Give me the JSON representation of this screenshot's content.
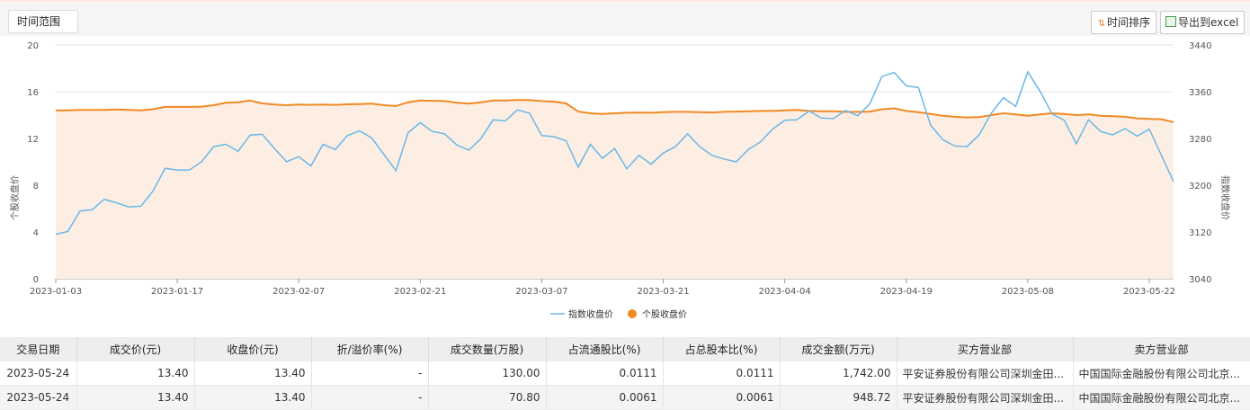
{
  "toolbar": {
    "range_label": "时间范围",
    "sort_label": "时间排序",
    "export_label": "导出到excel"
  },
  "colors": {
    "index_line": "#6bb7e6",
    "stock_line": "#f08a24",
    "stock_fill": "#fdeee3"
  },
  "chart_data": {
    "type": "line",
    "y_left_label": "个股收盘价",
    "y_right_label": "指数收盘价",
    "y_left_ticks": [
      "0",
      "4",
      "8",
      "12",
      "16",
      "20"
    ],
    "y_right_ticks": [
      "3040",
      "3120",
      "3200",
      "3280",
      "3360",
      "3440"
    ],
    "y_left_range": [
      0,
      20
    ],
    "y_right_range": [
      3040,
      3440
    ],
    "x_tick_labels": [
      "2023-01-03",
      "2023-01-17",
      "2023-02-07",
      "2023-02-21",
      "2023-03-07",
      "2023-03-21",
      "2023-04-04",
      "2023-04-19",
      "2023-05-08",
      "2023-05-22"
    ],
    "x_tick_positions": [
      0,
      10,
      20,
      30,
      40,
      50,
      60,
      70,
      80,
      90
    ],
    "grid": true,
    "legend_position": "bottom",
    "series": [
      {
        "name": "指数收盘价",
        "axis": "right",
        "values": [
          3116,
          3121,
          3156,
          3158,
          3176,
          3170,
          3163,
          3164,
          3190,
          3229,
          3226,
          3226,
          3240,
          3266,
          3270,
          3258,
          3286,
          3287,
          3263,
          3240,
          3249,
          3233,
          3270,
          3261,
          3285,
          3293,
          3281,
          3253,
          3225,
          3290,
          3307,
          3292,
          3288,
          3269,
          3260,
          3280,
          3312,
          3310,
          3329,
          3323,
          3285,
          3283,
          3276,
          3231,
          3270,
          3246,
          3263,
          3228,
          3251,
          3236,
          3255,
          3266,
          3288,
          3266,
          3251,
          3245,
          3240,
          3261,
          3274,
          3296,
          3311,
          3312,
          3327,
          3315,
          3314,
          3328,
          3319,
          3339,
          3386,
          3393,
          3370,
          3367,
          3303,
          3278,
          3267,
          3266,
          3286,
          3323,
          3350,
          3335,
          3394,
          3361,
          3322,
          3311,
          3271,
          3312,
          3292,
          3286,
          3297,
          3284,
          3296,
          3251,
          3206
        ]
      },
      {
        "name": "个股收盘价",
        "axis": "left",
        "values": [
          14.4,
          14.4,
          14.45,
          14.45,
          14.45,
          14.48,
          14.45,
          14.4,
          14.5,
          14.7,
          14.7,
          14.7,
          14.72,
          14.85,
          15.05,
          15.1,
          15.25,
          15.0,
          14.9,
          14.85,
          14.9,
          14.88,
          14.9,
          14.88,
          14.92,
          14.95,
          14.98,
          14.85,
          14.78,
          15.1,
          15.25,
          15.22,
          15.2,
          15.05,
          14.98,
          15.1,
          15.25,
          15.25,
          15.3,
          15.28,
          15.2,
          15.15,
          15.0,
          14.3,
          14.15,
          14.1,
          14.15,
          14.2,
          14.22,
          14.2,
          14.25,
          14.28,
          14.28,
          14.25,
          14.22,
          14.28,
          14.3,
          14.32,
          14.35,
          14.35,
          14.4,
          14.45,
          14.35,
          14.32,
          14.32,
          14.28,
          14.28,
          14.3,
          14.5,
          14.58,
          14.35,
          14.25,
          14.1,
          13.95,
          13.85,
          13.8,
          13.82,
          14.0,
          14.15,
          14.05,
          13.95,
          14.05,
          14.15,
          14.1,
          14.0,
          14.05,
          13.95,
          13.9,
          13.85,
          13.72,
          13.68,
          13.65,
          13.4
        ]
      }
    ]
  },
  "table": {
    "headers": [
      "交易日期",
      "成交价(元)",
      "收盘价(元)",
      "折/溢价率(%)",
      "成交数量(万股)",
      "占流通股比(%)",
      "占总股本比(%)",
      "成交金额(万元)",
      "买方营业部",
      "卖方营业部"
    ],
    "rows": [
      [
        "2023-05-24",
        "13.40",
        "13.40",
        "-",
        "130.00",
        "0.0111",
        "0.0111",
        "1,742.00",
        "平安证券股份有限公司深圳金田...",
        "中国国际金融股份有限公司北京..."
      ],
      [
        "2023-05-24",
        "13.40",
        "13.40",
        "-",
        "70.80",
        "0.0061",
        "0.0061",
        "948.72",
        "平安证券股份有限公司深圳金田...",
        "中国国际金融股份有限公司北京..."
      ]
    ]
  }
}
